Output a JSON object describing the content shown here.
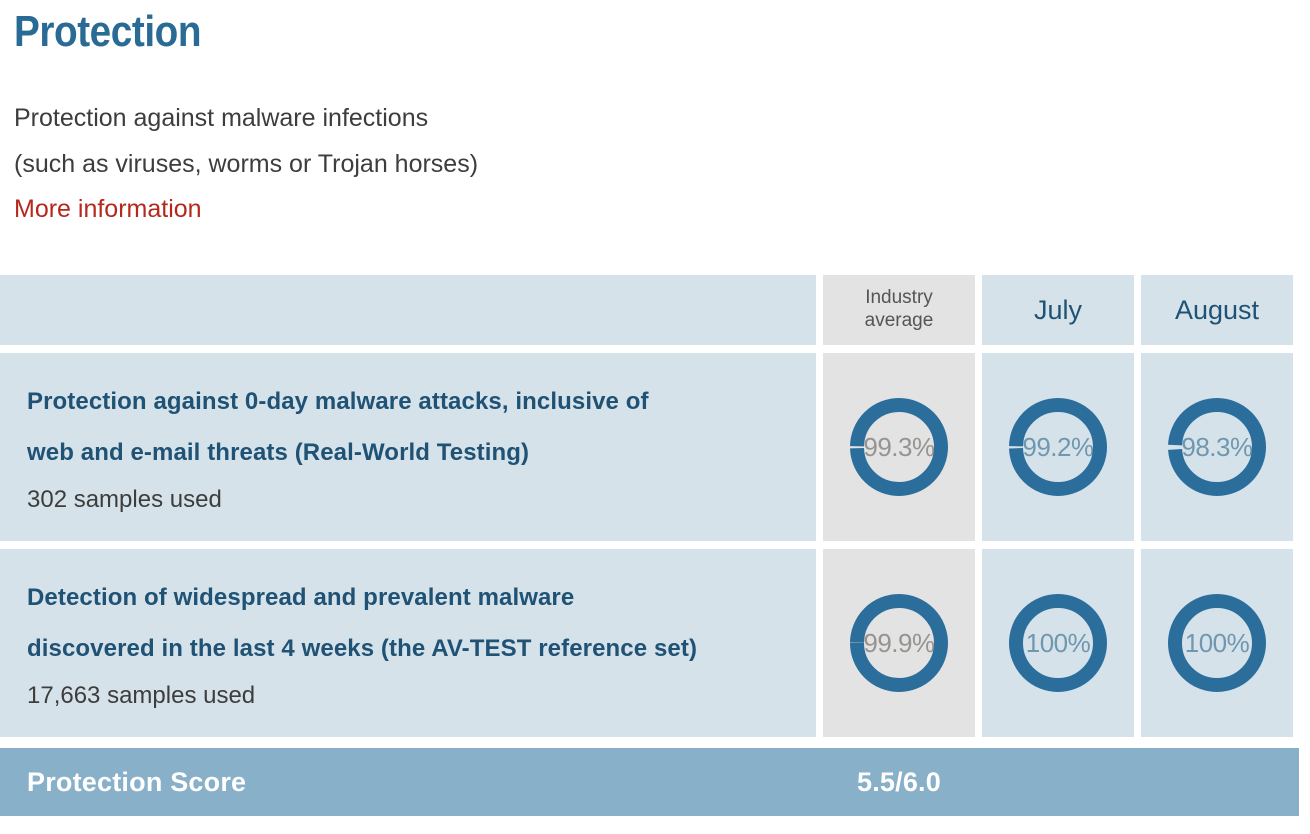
{
  "header": {
    "title": "Protection",
    "description_line1": "Protection against malware infections",
    "description_line2": "(such as viruses, worms or Trojan horses)",
    "more_information": "More information"
  },
  "colors": {
    "brand_blue": "#2a6b96",
    "dark_blue_text": "#1f5274",
    "cell_blue": "#d5e2ea",
    "cell_gray": "#e3e3e3",
    "ring_blue": "#2b6e9c",
    "link_red": "#b5281e",
    "score_bar": "#88b0c9"
  },
  "table": {
    "columns": [
      {
        "key": "label",
        "label": ""
      },
      {
        "key": "industry_average",
        "label_line1": "Industry",
        "label_line2": "average"
      },
      {
        "key": "july",
        "label": "July"
      },
      {
        "key": "august",
        "label": "August"
      }
    ],
    "rows": [
      {
        "title_line1": "Protection against 0-day malware attacks, inclusive of",
        "title_line2": "web and e-mail threats (Real-World Testing)",
        "samples": "302 samples used",
        "industry_average": "99.3%",
        "july": "99.2%",
        "august": "98.3%"
      },
      {
        "title_line1": "Detection of widespread and prevalent malware",
        "title_line2": "discovered in the last 4 weeks (the AV-TEST reference set)",
        "samples": "17,663 samples used",
        "industry_average": "99.9%",
        "july": "100%",
        "august": "100%"
      }
    ]
  },
  "score": {
    "label": "Protection Score",
    "value": "5.5/6.0"
  },
  "chart_data": {
    "type": "table",
    "title": "Protection",
    "categories": [
      "Industry average",
      "July",
      "August"
    ],
    "series": [
      {
        "name": "Protection against 0-day malware attacks, inclusive of web and e-mail threats (Real-World Testing)",
        "values": [
          99.3,
          99.2,
          98.3
        ],
        "unit": "%",
        "samples": 302
      },
      {
        "name": "Detection of widespread and prevalent malware discovered in the last 4 weeks (the AV-TEST reference set)",
        "values": [
          99.9,
          100,
          100
        ],
        "unit": "%",
        "samples": 17663
      }
    ],
    "ylim": [
      0,
      100
    ],
    "score": 5.5,
    "score_max": 6.0
  }
}
